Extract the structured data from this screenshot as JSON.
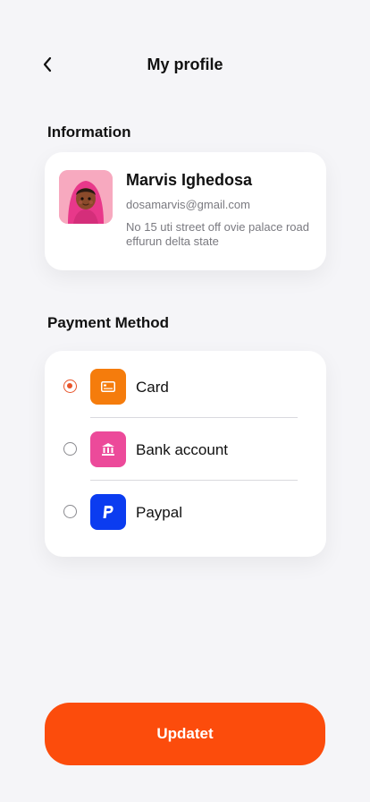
{
  "header": {
    "title": "My profile",
    "back_icon": "chevron-left-icon"
  },
  "information": {
    "section_title": "Information",
    "name": "Marvis Ighedosa",
    "email": "dosamarvis@gmail.com",
    "address": "No 15 uti street off ovie palace road effurun delta state"
  },
  "payment": {
    "section_title": "Payment Method",
    "methods": [
      {
        "label": "Card",
        "icon": "card-icon",
        "color": "#f57c0c",
        "selected": true
      },
      {
        "label": "Bank account",
        "icon": "bank-icon",
        "color": "#ec4a9a",
        "selected": false
      },
      {
        "label": "Paypal",
        "icon": "paypal-icon",
        "color": "#0b3cf0",
        "selected": false
      }
    ]
  },
  "actions": {
    "update_label": "Updatet"
  },
  "colors": {
    "accent": "#fc4c0c",
    "radio_selected": "#e8542a",
    "background": "#f5f5f8"
  }
}
